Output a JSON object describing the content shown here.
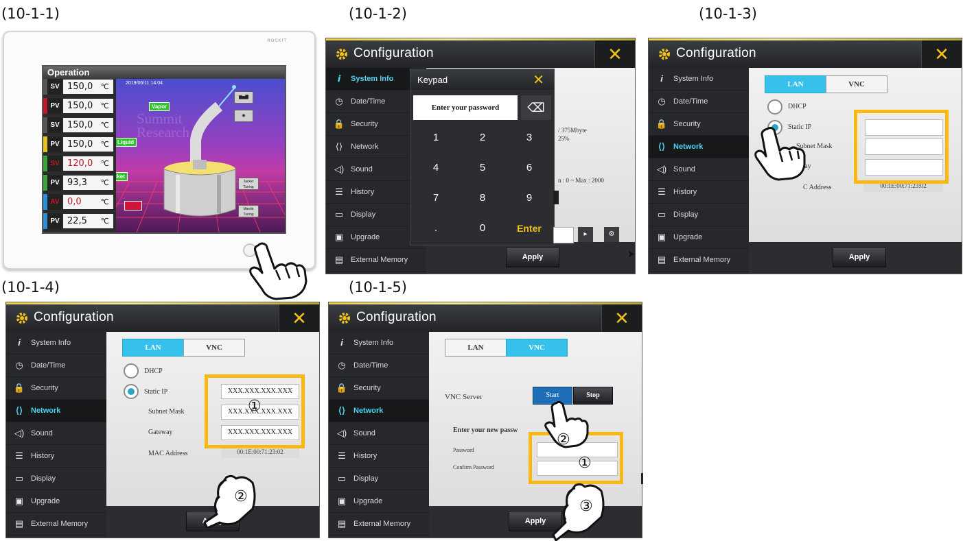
{
  "captions": {
    "p1": "(10-1-1)",
    "p2": "(10-1-2)",
    "p3": "(10-1-3)",
    "p4": "(10-1-4)",
    "p5": "(10-1-5)"
  },
  "config_title": "Configuration",
  "close_glyph": "✕",
  "sidebar_items": [
    {
      "label": "System Info",
      "icon": "info-icon"
    },
    {
      "label": "Date/Time",
      "icon": "clock-icon"
    },
    {
      "label": "Security",
      "icon": "lock-icon"
    },
    {
      "label": "Network",
      "icon": "network-icon"
    },
    {
      "label": "Sound",
      "icon": "speaker-icon"
    },
    {
      "label": "History",
      "icon": "list-icon"
    },
    {
      "label": "Display",
      "icon": "monitor-icon"
    },
    {
      "label": "Upgrade",
      "icon": "upgrade-icon"
    },
    {
      "label": "External Memory",
      "icon": "disk-icon"
    }
  ],
  "apply_label": "Apply",
  "device": {
    "brand": "ROCKIT",
    "operation_title": "Operation",
    "datetime": "2019/06/11 14:04",
    "rows": [
      {
        "tag": "SV",
        "value": "150,0",
        "unit": "℃",
        "color": "#555555"
      },
      {
        "tag": "PV",
        "value": "150,0",
        "unit": "℃",
        "color": "#c0182a"
      },
      {
        "tag": "SV",
        "value": "150,0",
        "unit": "℃",
        "color": "#555555"
      },
      {
        "tag": "PV",
        "value": "150,0",
        "unit": "℃",
        "color": "#e3c31a"
      },
      {
        "tag": "SV",
        "value": "120,0",
        "unit": "℃",
        "color": "#3aa33a",
        "value_color": "#c0182a"
      },
      {
        "tag": "PV",
        "value": "93,3",
        "unit": "℃",
        "color": "#3aa33a"
      },
      {
        "tag": "AV",
        "value": "0,0",
        "unit": "℃",
        "color": "#2a8fd8",
        "value_color": "#c0182a"
      },
      {
        "tag": "PV",
        "value": "22,5",
        "unit": "℃",
        "color": "#2a8fd8"
      }
    ],
    "watermark": "Summit Research",
    "labels": {
      "vapor": "Vapor",
      "liquid": "Liquid",
      "jacket": "Jacket",
      "jacket_tuning": "Jacket Tuning",
      "mantle_tuning": "Mantle Tuning"
    }
  },
  "keypad": {
    "title": "Keypad",
    "prompt": "Enter your password",
    "backspace": "⌫",
    "keys": [
      "1",
      "2",
      "3",
      "4",
      "5",
      "6",
      "7",
      "8",
      "9",
      ".",
      "0",
      "Enter"
    ]
  },
  "panel2_bg": {
    "line1": "/ 375Mbyte",
    "line2": "25%",
    "line3": "n : 0 ~ Max : 2000"
  },
  "network": {
    "tab_lan": "LAN",
    "tab_vnc": "VNC",
    "dhcp": "DHCP",
    "static_ip": "Static IP",
    "subnet_mask": "Subnet Mask",
    "gateway": "Gateway",
    "mac_address": "MAC Address",
    "mac_value": "00:1E:00:71:23:02",
    "panel3_gateway_partial": "way",
    "panel3_mac_partial": "C Address",
    "ip_placeholder": "XXX.XXX.XXX.XXX"
  },
  "vnc": {
    "server_label": "VNC Server",
    "start": "Start",
    "stop": "Stop",
    "new_password_prompt": "Enter your new passw",
    "password": "Password",
    "confirm_password": "Confirm Password"
  },
  "step_marks": {
    "one": "①",
    "two": "②",
    "three": "③"
  },
  "colors": {
    "highlight": "#f9b914",
    "accent_cyan": "#36c1ec",
    "close_yellow": "#f2c317"
  }
}
